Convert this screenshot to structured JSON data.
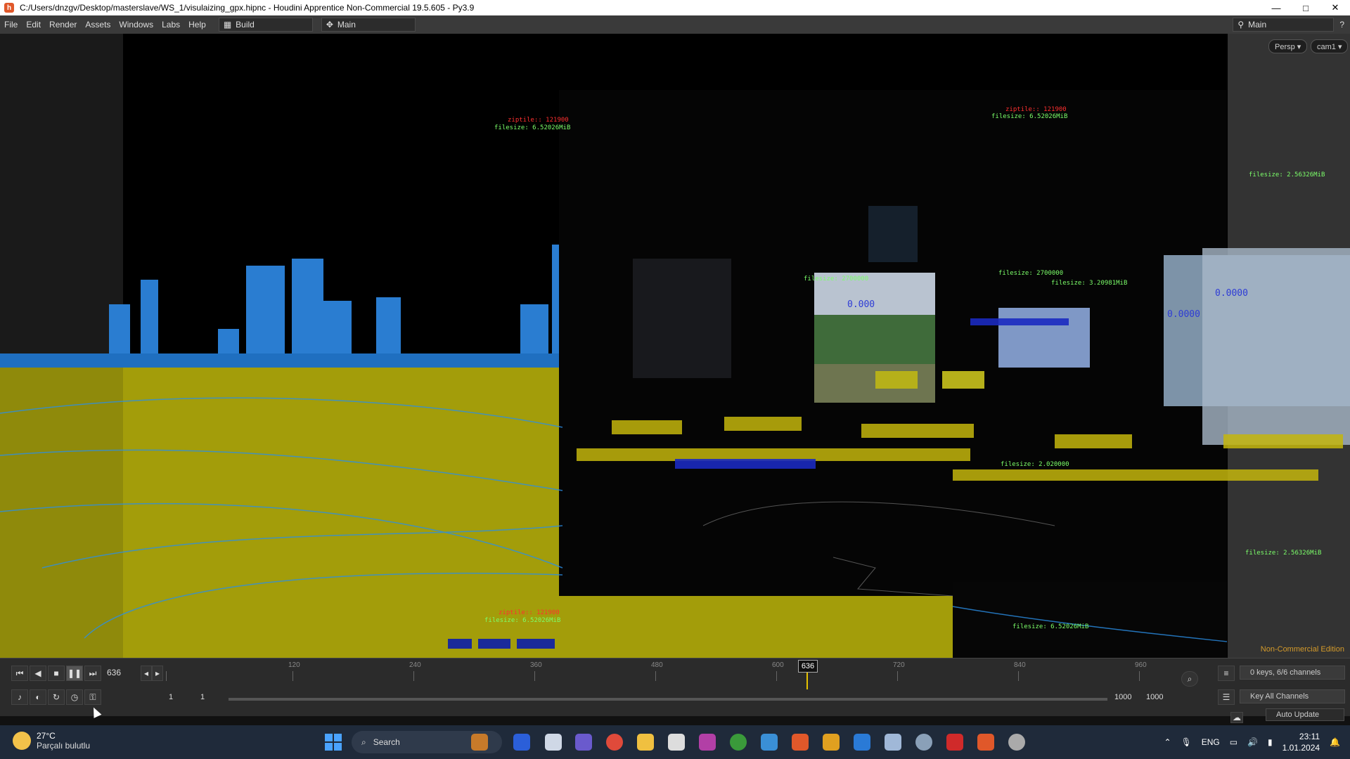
{
  "window": {
    "title": "C:/Users/dnzgv/Desktop/masterslave/WS_1/visulaizing_gpx.hipnc - Houdini Apprentice Non-Commercial 19.5.605 - Py3.9",
    "minimize": "—",
    "maximize": "□",
    "close": "✕"
  },
  "menu": [
    "File",
    "Edit",
    "Render",
    "Assets",
    "Windows",
    "Labs",
    "Help"
  ],
  "desktops": {
    "build": "Build",
    "main": "Main"
  },
  "menu_right": {
    "desktop": "Main"
  },
  "viewport": {
    "persp": "Persp ▾",
    "cam": "cam1 ▾",
    "edition": "Non-Commercial Edition",
    "labels": [
      {
        "t": "filesize: 6.52026MiB",
        "c": "g"
      },
      {
        "t": "filesize: 6.52026MiB",
        "c": "g"
      },
      {
        "t": "filesize: 2.56326MiB",
        "c": "g"
      },
      {
        "t": "filesize: 2700000",
        "c": "g"
      },
      {
        "t": "filesize: 2700000",
        "c": "g"
      },
      {
        "t": "filesize: 3.20981MiB",
        "c": "g"
      },
      {
        "t": "filesize: 2.020000",
        "c": "g"
      },
      {
        "t": "filesize: 2.56326MiB",
        "c": "g"
      },
      {
        "t": "filesize: 6.52026MiB",
        "c": "g"
      },
      {
        "t": "filesize: 6.52026MiB",
        "c": "g"
      },
      {
        "t": "0.0000",
        "c": "b"
      },
      {
        "t": "0.0000",
        "c": "b"
      },
      {
        "t": "0.000",
        "c": "b"
      }
    ]
  },
  "playbar": {
    "current_frame": "636",
    "marker": "636",
    "ticks": [
      "120",
      "240",
      "360",
      "480",
      "600",
      "720",
      "840",
      "960"
    ],
    "start_a": "1",
    "start_b": "1",
    "end_a": "1000",
    "end_b": "1000",
    "keys_info": "0 keys, 6/6 channels",
    "key_all": "Key All Channels",
    "auto_update": "Auto Update"
  },
  "taskbar": {
    "temp": "27°C",
    "weather": "Parçalı bulutlu",
    "search": "Search",
    "lang": "ENG",
    "time": "23:11",
    "date": "1.01.2024"
  },
  "colors": {
    "ground": "#a39d0a",
    "building": "#2a7dd1",
    "label_green": "#7cff6a",
    "label_red": "#ff3030",
    "label_blue": "#2d3bd6",
    "edition": "#d49a2a"
  }
}
